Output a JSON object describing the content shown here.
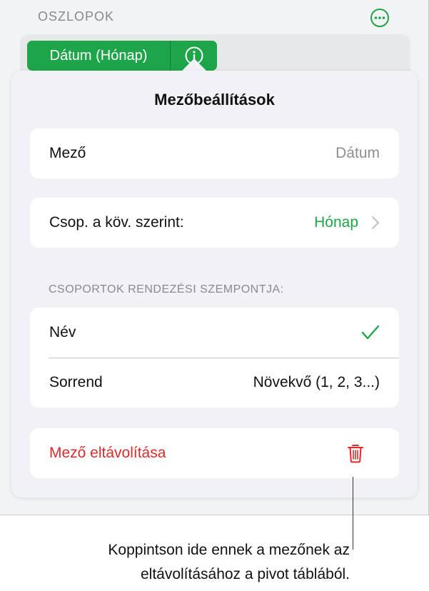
{
  "header": {
    "section_title": "OSZLOPOK",
    "more_icon": "ellipsis-circle-icon"
  },
  "chip": {
    "label": "Dátum (Hónap)",
    "info_icon": "info-icon"
  },
  "popover": {
    "title": "Mezőbeállítások",
    "field_row": {
      "label": "Mező",
      "value": "Dátum"
    },
    "group_row": {
      "label": "Csop. a köv. szerint:",
      "value": "Hónap"
    },
    "sort_header": "CSOPORTOK RENDEZÉSI SZEMPONTJA:",
    "sort_rows": [
      {
        "label": "Név",
        "checked": true
      },
      {
        "label": "Sorrend",
        "value": "Növekvő (1, 2, 3...)"
      }
    ],
    "remove": {
      "label": "Mező eltávolítása",
      "icon": "trash-icon"
    }
  },
  "callout": {
    "line1": "Koppintson ide ennek a mezőnek az",
    "line2": "eltávolításához a pivot táblából."
  },
  "colors": {
    "accent_green": "#1ea549",
    "destructive_red": "#e02a2a",
    "secondary_gray": "#8e8e93"
  }
}
